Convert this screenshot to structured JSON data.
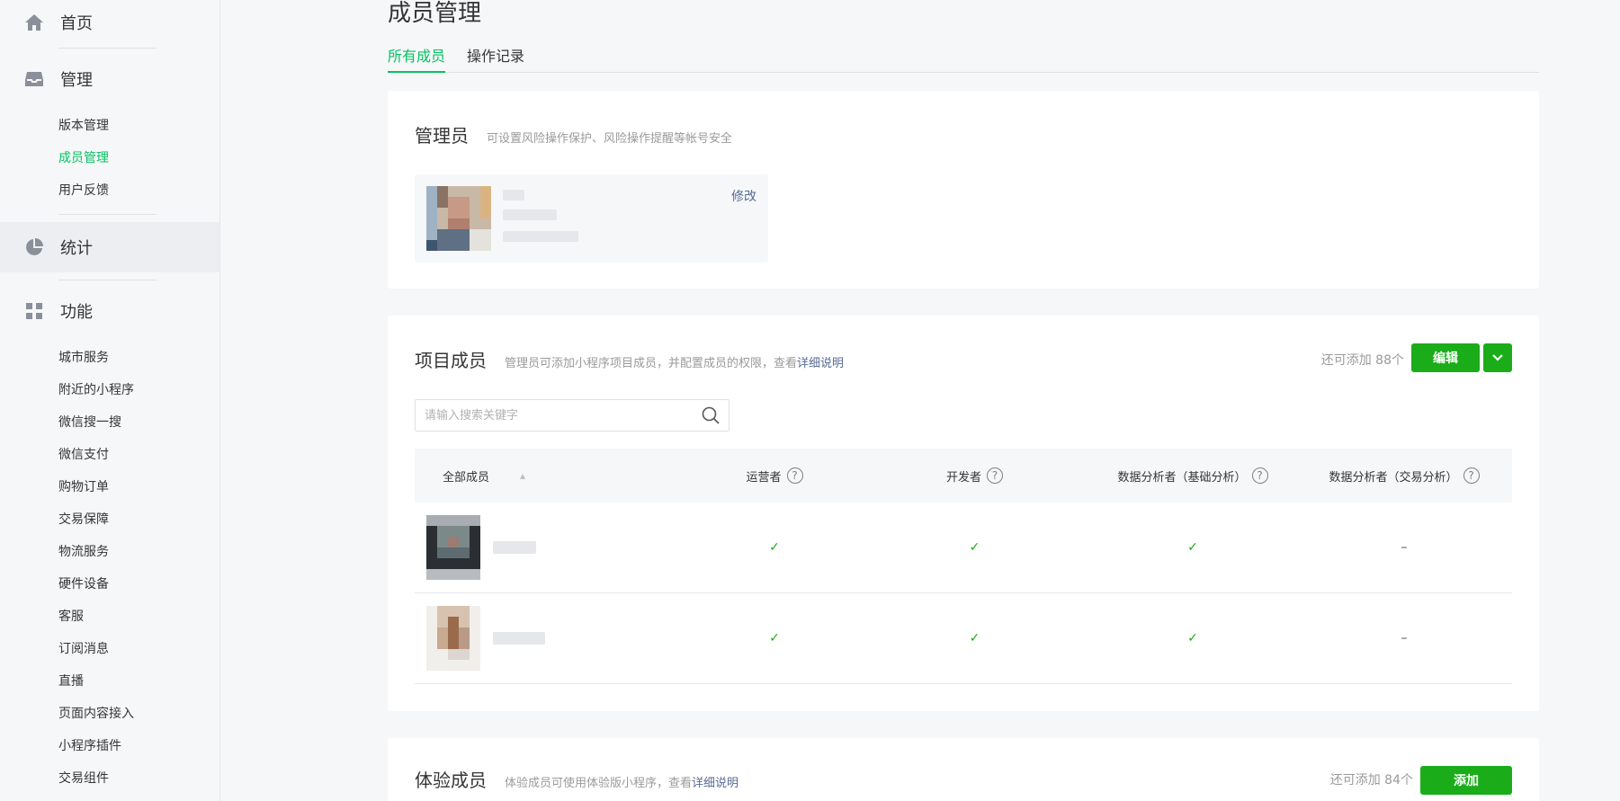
{
  "sidebar": {
    "home": "首页",
    "manage": {
      "label": "管理",
      "items": [
        {
          "label": "版本管理",
          "active": false
        },
        {
          "label": "成员管理",
          "active": true
        },
        {
          "label": "用户反馈",
          "active": false
        }
      ]
    },
    "stats": "统计",
    "features": {
      "label": "功能",
      "items": [
        "城市服务",
        "附近的小程序",
        "微信搜一搜",
        "微信支付",
        "购物订单",
        "交易保障",
        "物流服务",
        "硬件设备",
        "客服",
        "订阅消息",
        "直播",
        "页面内容接入",
        "小程序插件",
        "交易组件"
      ]
    }
  },
  "page": {
    "title": "成员管理",
    "tabs": [
      "所有成员",
      "操作记录"
    ]
  },
  "admin": {
    "title": "管理员",
    "desc": "可设置风险操作保护、风险操作提醒等帐号安全",
    "edit": "修改"
  },
  "members": {
    "title": "项目成员",
    "desc_prefix": "管理员可添加小程序项目成员，并配置成员的权限，查看",
    "desc_link": "详细说明",
    "quota": "还可添加 88个",
    "edit_button": "编辑",
    "search_placeholder": "请输入搜索关键字",
    "columns": [
      "全部成员",
      "运营者",
      "开发者",
      "数据分析者（基础分析）",
      "数据分析者（交易分析）"
    ],
    "rows": [
      {
        "operator": "✓",
        "developer": "✓",
        "analyst_basic": "✓",
        "analyst_trade": "–"
      },
      {
        "operator": "✓",
        "developer": "✓",
        "analyst_basic": "✓",
        "analyst_trade": "–"
      }
    ]
  },
  "trial": {
    "title": "体验成员",
    "desc_prefix": "体验成员可使用体验版小程序，查看",
    "desc_link": "详细说明",
    "quota": "还可添加 84个",
    "add_button": "添加"
  },
  "colors": {
    "accent": "#07c160",
    "button": "#1aad19",
    "link": "#576b95"
  }
}
